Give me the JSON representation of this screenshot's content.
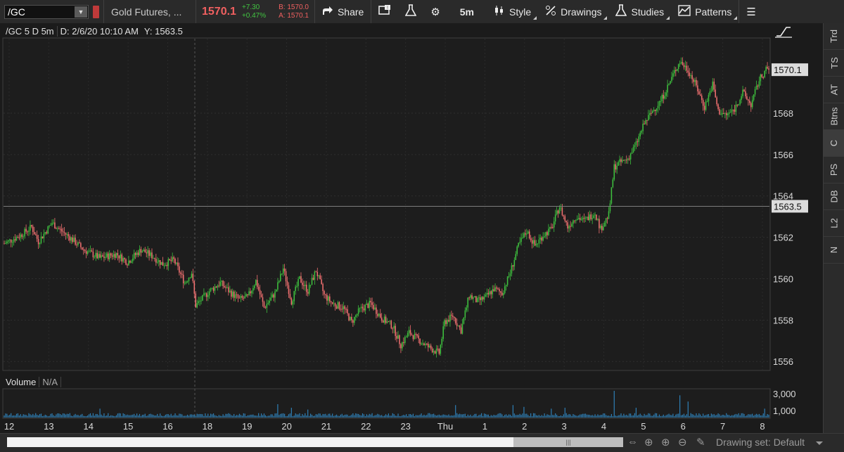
{
  "toolbar": {
    "symbol": "/GC",
    "instrument_name": "Gold Futures, ...",
    "last_price": "1570.1",
    "net_change": "+7.30",
    "pct_change": "+0.47%",
    "bid": "B: 1570.0",
    "ask": "A: 1570.1",
    "share_label": "Share",
    "timeframe_label": "5m",
    "style_label": "Style",
    "drawings_label": "Drawings",
    "studies_label": "Studies",
    "patterns_label": "Patterns"
  },
  "chart_header": {
    "title": "/GC 5 D 5m",
    "date": "D: 2/6/20 10:10 AM",
    "cursor_y": "Y: 1563.5"
  },
  "volume_header": {
    "label": "Volume",
    "value": "N/A"
  },
  "side_tabs": [
    "Trd",
    "TS",
    "AT",
    "Btns",
    "C",
    "PS",
    "DB",
    "L2",
    "N"
  ],
  "active_side_tab": "C",
  "drawing_set": "Drawing set: Default",
  "colors": {
    "up": "#3ec03e",
    "down": "#f07070",
    "volume": "#2f7fb5",
    "background": "#1b1b1b"
  },
  "chart_data": {
    "type": "candlestick",
    "x_labels": [
      "12",
      "13",
      "14",
      "15",
      "16",
      "18",
      "19",
      "20",
      "21",
      "22",
      "23",
      "Thu",
      "1",
      "2",
      "3",
      "4",
      "5",
      "6",
      "7",
      "8"
    ],
    "y_ticks": [
      1556,
      1558,
      1560,
      1562,
      1564,
      1566,
      1568
    ],
    "ylim": [
      1555.6,
      1571.6
    ],
    "last_price_label": "1570.1",
    "last_price": 1570.1,
    "crosshair_price_label": "1563.5",
    "crosshair_price": 1563.5,
    "volume_ticks": [
      "3,000",
      "1,000"
    ],
    "close_path": [
      [
        0,
        1561.7
      ],
      [
        12,
        1562.1
      ],
      [
        20,
        1562.5
      ],
      [
        25,
        1561.8
      ],
      [
        35,
        1562.7
      ],
      [
        40,
        1562.4
      ],
      [
        48,
        1562.0
      ],
      [
        58,
        1561.4
      ],
      [
        70,
        1561.0
      ],
      [
        82,
        1561.2
      ],
      [
        90,
        1560.8
      ],
      [
        100,
        1561.4
      ],
      [
        108,
        1561.1
      ],
      [
        116,
        1560.7
      ],
      [
        124,
        1560.9
      ],
      [
        132,
        1559.8
      ],
      [
        137,
        1560.3
      ],
      [
        140,
        1558.7
      ],
      [
        150,
        1559.4
      ],
      [
        158,
        1559.8
      ],
      [
        166,
        1559.3
      ],
      [
        172,
        1559.0
      ],
      [
        178,
        1559.1
      ],
      [
        184,
        1559.9
      ],
      [
        190,
        1558.6
      ],
      [
        198,
        1559.3
      ],
      [
        204,
        1560.5
      ],
      [
        210,
        1558.9
      ],
      [
        216,
        1560.0
      ],
      [
        222,
        1559.4
      ],
      [
        228,
        1560.4
      ],
      [
        234,
        1559.2
      ],
      [
        240,
        1558.8
      ],
      [
        248,
        1558.6
      ],
      [
        254,
        1557.9
      ],
      [
        260,
        1558.5
      ],
      [
        268,
        1558.8
      ],
      [
        276,
        1558.1
      ],
      [
        284,
        1557.7
      ],
      [
        290,
        1556.8
      ],
      [
        296,
        1557.4
      ],
      [
        302,
        1557.1
      ],
      [
        310,
        1556.7
      ],
      [
        318,
        1556.4
      ],
      [
        322,
        1557.9
      ],
      [
        328,
        1558.2
      ],
      [
        334,
        1557.5
      ],
      [
        340,
        1559.2
      ],
      [
        346,
        1558.9
      ],
      [
        352,
        1559.1
      ],
      [
        358,
        1559.5
      ],
      [
        364,
        1559.3
      ],
      [
        370,
        1560.3
      ],
      [
        376,
        1561.6
      ],
      [
        382,
        1562.3
      ],
      [
        388,
        1561.6
      ],
      [
        394,
        1562.1
      ],
      [
        400,
        1562.4
      ],
      [
        406,
        1563.5
      ],
      [
        412,
        1562.5
      ],
      [
        418,
        1563.0
      ],
      [
        424,
        1562.8
      ],
      [
        432,
        1563.2
      ],
      [
        436,
        1562.4
      ],
      [
        442,
        1563.1
      ],
      [
        446,
        1565.4
      ],
      [
        450,
        1565.6
      ],
      [
        456,
        1565.8
      ],
      [
        462,
        1566.5
      ],
      [
        468,
        1567.5
      ],
      [
        474,
        1568.1
      ],
      [
        480,
        1568.6
      ],
      [
        486,
        1569.4
      ],
      [
        490,
        1570.0
      ],
      [
        494,
        1570.5
      ],
      [
        500,
        1570.1
      ],
      [
        506,
        1569.3
      ],
      [
        512,
        1568.3
      ],
      [
        518,
        1569.4
      ],
      [
        522,
        1568.1
      ],
      [
        528,
        1567.9
      ],
      [
        534,
        1568.2
      ],
      [
        540,
        1569.0
      ],
      [
        546,
        1568.4
      ],
      [
        552,
        1569.6
      ],
      [
        557,
        1570.1
      ]
    ],
    "volume_spikes": [
      [
        70,
        1000
      ],
      [
        200,
        1500
      ],
      [
        210,
        1100
      ],
      [
        222,
        900
      ],
      [
        330,
        1400
      ],
      [
        372,
        1400
      ],
      [
        380,
        1200
      ],
      [
        400,
        1000
      ],
      [
        410,
        1100
      ],
      [
        446,
        3000
      ],
      [
        462,
        1100
      ],
      [
        494,
        2500
      ],
      [
        500,
        1800
      ],
      [
        556,
        1000
      ]
    ]
  }
}
